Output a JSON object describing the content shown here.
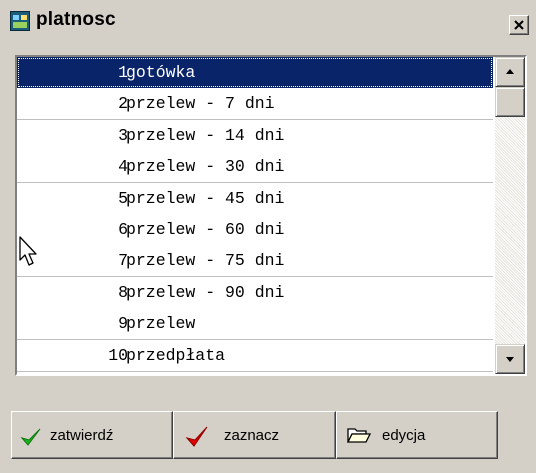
{
  "window": {
    "title": "platnosc"
  },
  "list": {
    "items": [
      {
        "num": "1",
        "name": "gotówka",
        "selected": true
      },
      {
        "num": "2",
        "name": "przelew - 7 dni"
      },
      {
        "num": "3",
        "name": "przelew - 14 dni"
      },
      {
        "num": "4",
        "name": "przelew - 30 dni"
      },
      {
        "num": "5",
        "name": "przelew - 45 dni"
      },
      {
        "num": "6",
        "name": "przelew - 60 dni"
      },
      {
        "num": "7",
        "name": "przelew - 75 dni"
      },
      {
        "num": "8",
        "name": "przelew - 90 dni"
      },
      {
        "num": "9",
        "name": "przelew"
      },
      {
        "num": "10",
        "name": "przedpłata"
      }
    ]
  },
  "buttons": {
    "confirm": {
      "label": "zatwierdź",
      "icon": "green-checkmark-icon"
    },
    "mark": {
      "label": "zaznacz",
      "icon": "red-checkmark-icon"
    },
    "edit": {
      "label": "edycja",
      "icon": "open-folder-icon"
    }
  },
  "colors": {
    "selection": "#0a246a",
    "face": "#d4d0c8",
    "check_green": "#20b020",
    "check_red": "#e00000"
  }
}
